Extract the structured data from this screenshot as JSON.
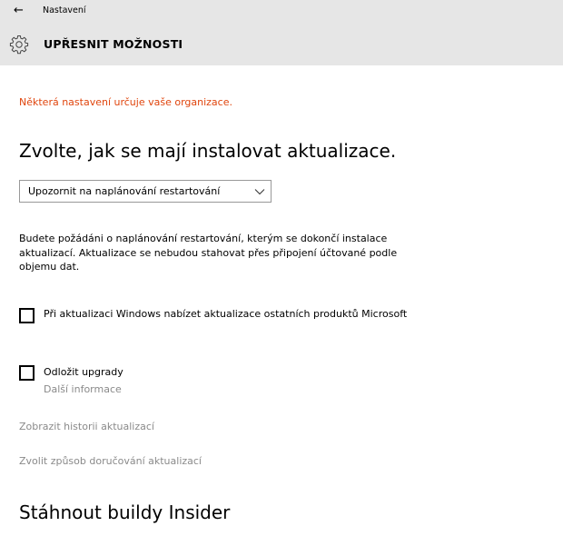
{
  "header": {
    "back_icon": "←",
    "app_title": "Nastavení",
    "gear_icon": "gear-icon",
    "page_title": "UPŘESNIT MOŽNOSTI",
    "background": "#e6e6e6"
  },
  "content": {
    "org_notice": "Některá nastavení určuje vaše organizace.",
    "org_notice_color": "#e0450d",
    "install_heading": "Zvolte, jak se mají instalovat aktualizace.",
    "install_mode": {
      "selected": "Upozornit na naplánování restartování",
      "icon": "chevron-down-icon"
    },
    "description": "Budete požádáni o naplánování restartování, kterým se dokončí instalace aktualizací. Aktualizace se nebudou stahovat přes připojení účtované podle objemu dat.",
    "option_other_products": {
      "label": "Při aktualizaci Windows nabízet aktualizace ostatních produktů Microsoft",
      "checked": false
    },
    "option_defer": {
      "label": "Odložit upgrady",
      "checked": false,
      "more_info": "Další informace"
    },
    "links": {
      "history": "Zobrazit historii aktualizací",
      "delivery": "Zvolit způsob doručování aktualizací"
    },
    "link_color": "#8a8a8a",
    "insider_heading": "Stáhnout buildy Insider"
  }
}
